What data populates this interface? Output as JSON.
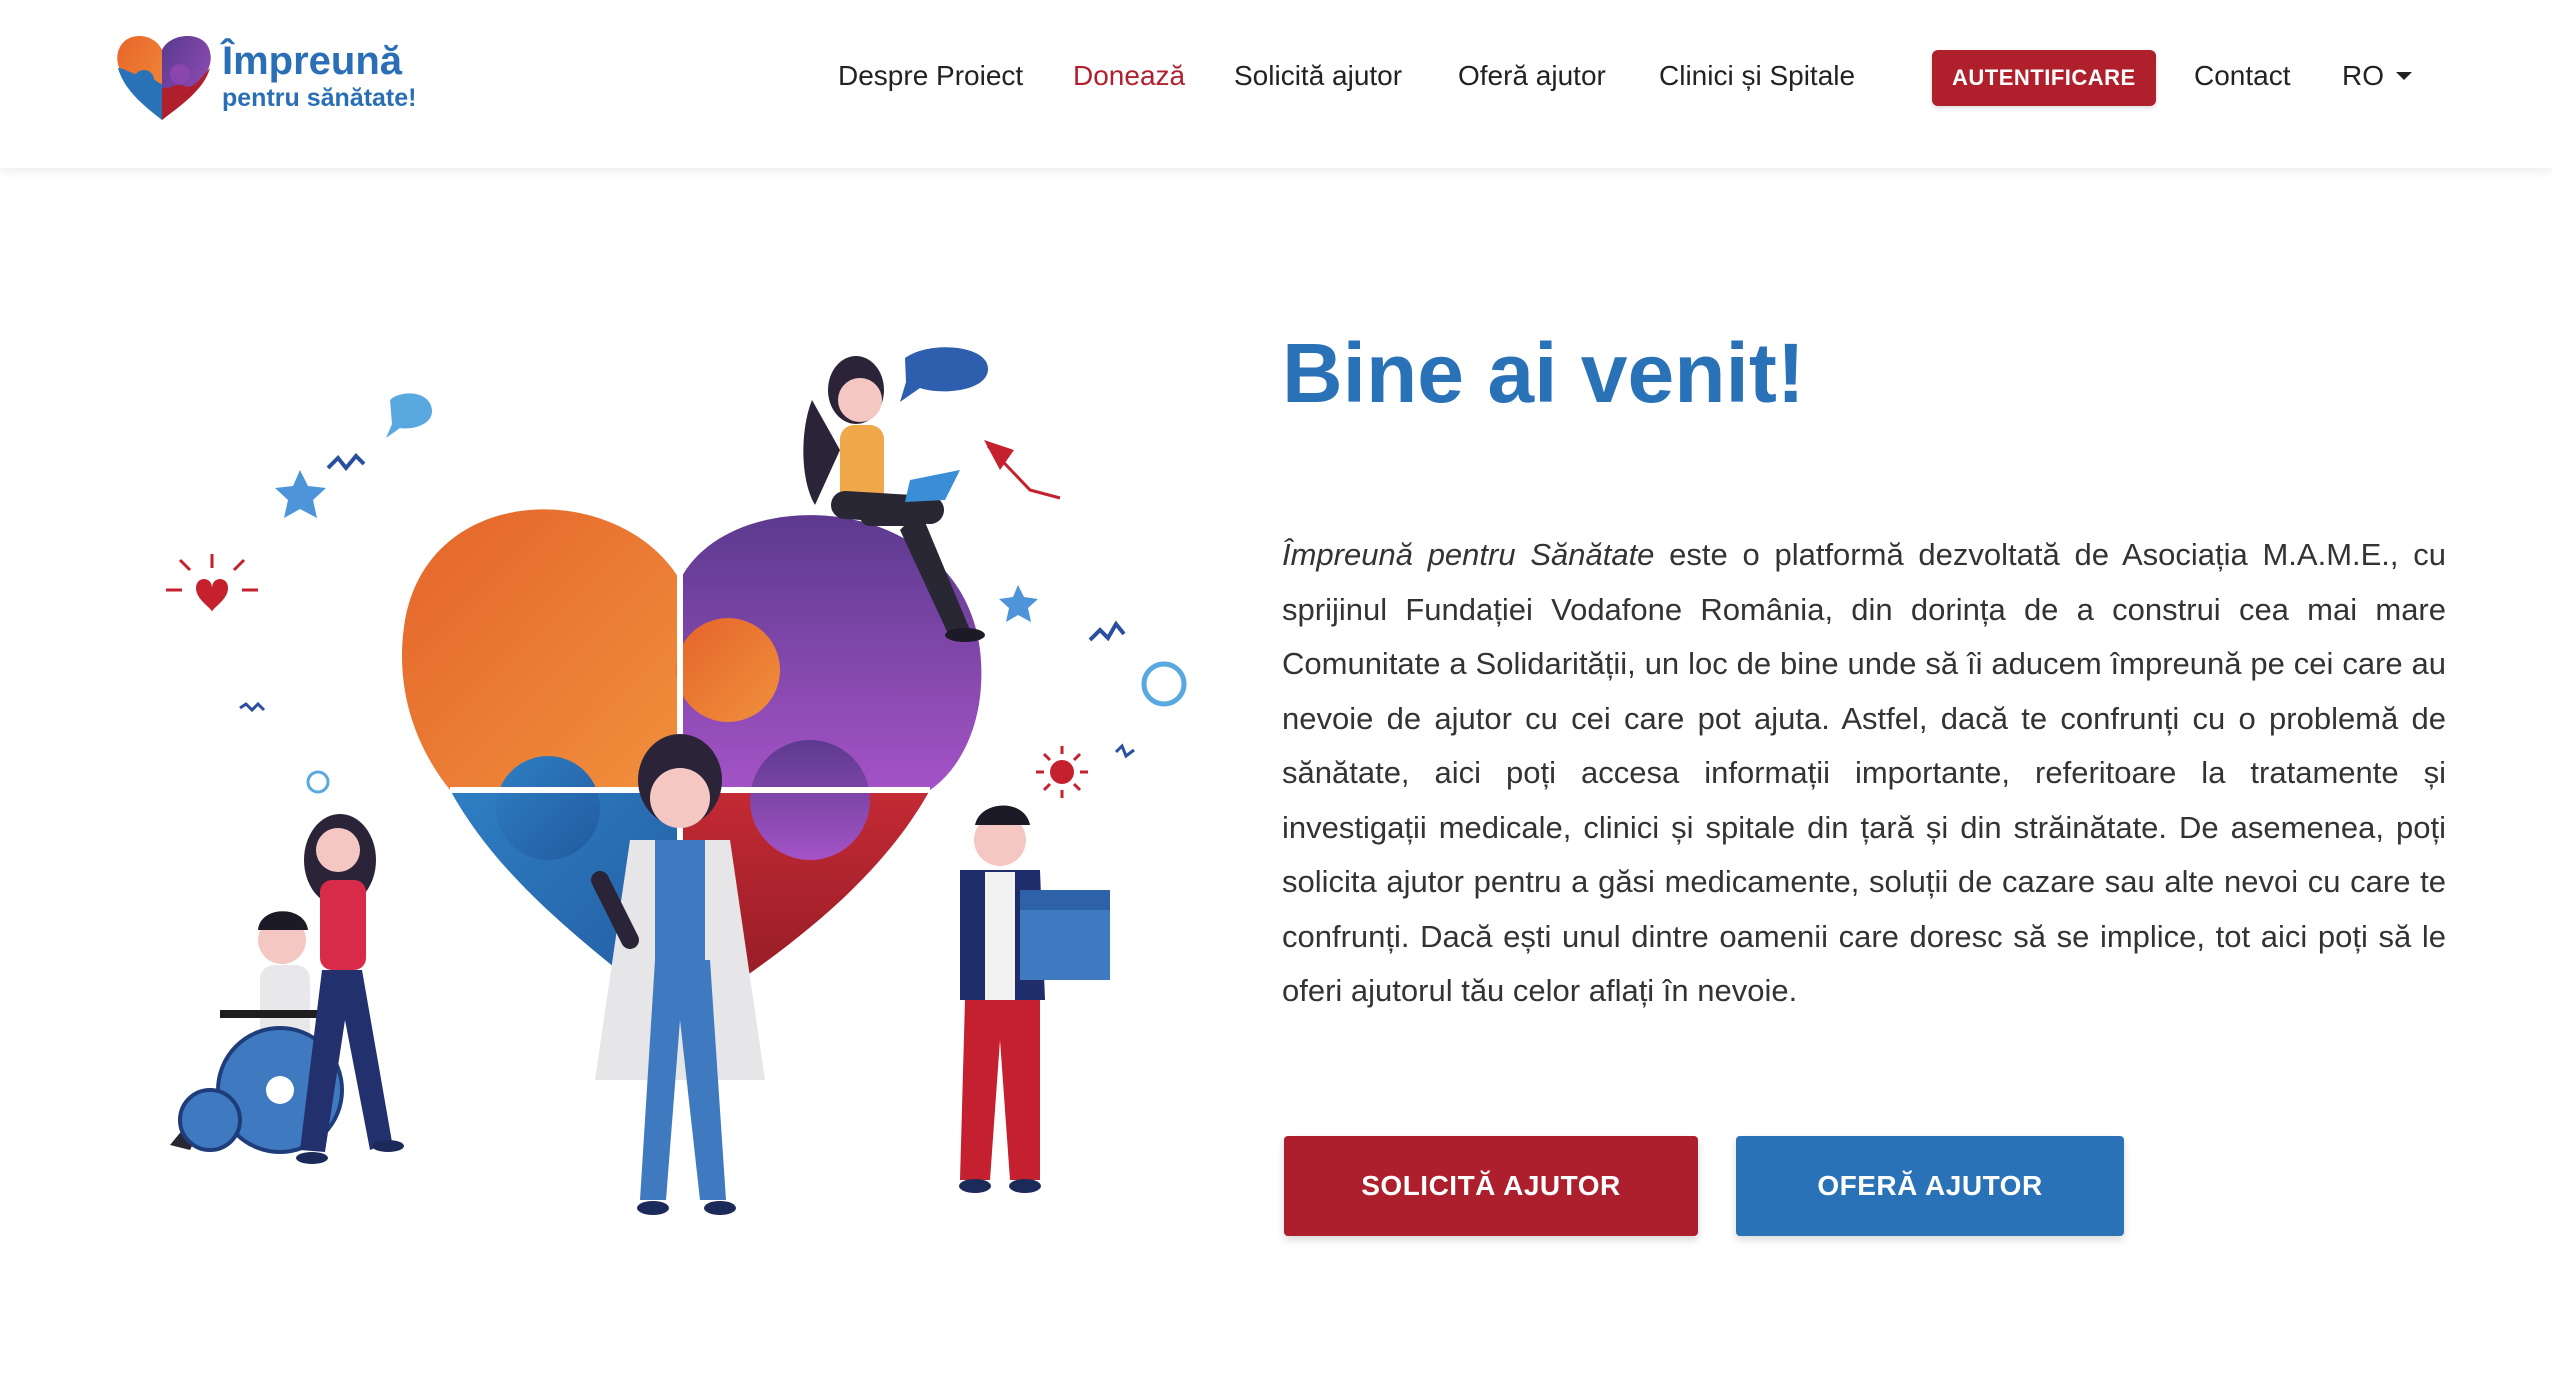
{
  "brand": {
    "title": "Împreună",
    "subtitle": "pentru sănătate!"
  },
  "nav": {
    "items": [
      {
        "label": "Despre Proiect"
      },
      {
        "label": "Donează"
      },
      {
        "label": "Solicită ajutor"
      },
      {
        "label": "Oferă ajutor"
      },
      {
        "label": "Clinici și Spitale"
      }
    ],
    "auth_label": "AUTENTIFICARE",
    "contact_label": "Contact",
    "language": "RO"
  },
  "hero": {
    "title": "Bine ai venit!",
    "text_italic": "Împreună pentru Sănătate",
    "text": " este o platformă dezvoltată de Asociația M.A.M.E., cu sprijinul Fundației Vodafone România, din dorința de a construi cea mai mare Comunitate a Solidarității, un loc de bine unde să îi aducem împreună pe cei care au nevoie de ajutor cu cei care pot ajuta. Astfel, dacă te confrunți cu o problemă de sănătate, aici poți accesa informații importante, referitoare la tratamente și investigații medicale, clinici și spitale din țară și din străinătate. De asemenea, poți solicita ajutor pentru a găsi medicamente, soluții de cazare sau alte nevoi cu care te confrunți. Dacă ești unul dintre oamenii care doresc să se implice, tot aici poți să le oferi ajutorul tău celor aflați în nevoie.",
    "cta_request": "SOLICITĂ AJUTOR",
    "cta_offer": "OFERĂ AJUTOR"
  },
  "colors": {
    "brand_blue": "#2a72b8",
    "brand_red": "#ad1f2c",
    "puzzle_orange": "#e8722a",
    "puzzle_purple": "#7b3f9c"
  },
  "icons": [
    "heart-puzzle-logo-icon",
    "chevron-down-icon"
  ]
}
